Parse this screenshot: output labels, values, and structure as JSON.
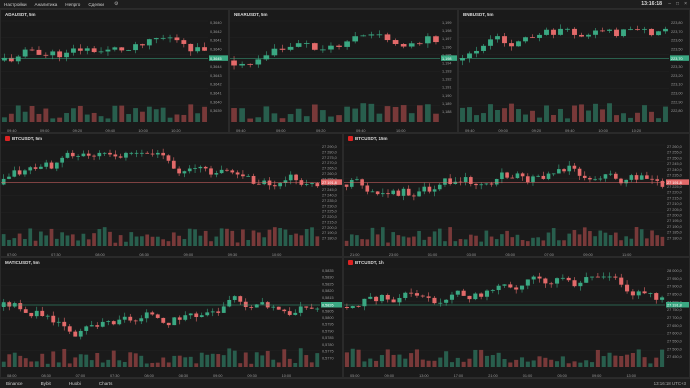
{
  "menu": {
    "items": [
      "Настройки",
      "Аналитика",
      "Непрго",
      "Сделки"
    ]
  },
  "clock": "13:16:18",
  "window_controls": [
    "–",
    "□",
    "×"
  ],
  "colors": {
    "bull": "#3aa882",
    "bear": "#e36a6a",
    "vol_bull": "#2c6b57",
    "vol_bear": "#8a4040",
    "hline_green": "#3aa882",
    "hline_red": "#e36a6a",
    "active_head": "#273b66"
  },
  "panels": [
    {
      "id": "ada",
      "title": "ADAUSDT, 5m",
      "badge": false,
      "active": false,
      "y_ticks": [
        "0,3640",
        "0,3642",
        "0,3641",
        "0,3640",
        "0,3645",
        "0,3644",
        "0,3643",
        "0,3642",
        "0,3641",
        "0,3640",
        "0,3639"
      ],
      "x_ticks": [
        "09:40",
        "09:00",
        "09:20",
        "09:40",
        "10:00",
        "10:20"
      ],
      "price_tag": "0,3645",
      "tag_color": "#3aa882"
    },
    {
      "id": "near",
      "title": "NEARUSDT, 5m",
      "badge": false,
      "active": false,
      "y_ticks": [
        "1,199",
        "1,198",
        "1,197",
        "1,196",
        "1,195",
        "1,194",
        "1,193",
        "1,192",
        "1,191",
        "1,190",
        "1,189",
        "1,188"
      ],
      "x_ticks": [
        "09:40",
        "09:00",
        "09:20",
        "09:40",
        "10:00"
      ],
      "price_tag": "1,198",
      "tag_color": "#3aa882"
    },
    {
      "id": "bnb",
      "title": "BNBUSDT, 5m",
      "badge": false,
      "active": false,
      "y_ticks": [
        "223,80",
        "223,70",
        "223,60",
        "223,50",
        "223,40",
        "223,30",
        "223,20",
        "223,10",
        "223,00",
        "222,90",
        "222,80"
      ],
      "x_ticks": [
        "09:40",
        "09:00",
        "09:20",
        "09:40",
        "10:00",
        "10:20"
      ],
      "price_tag": "223,70",
      "tag_color": "#3aa882"
    },
    {
      "id": "btc5",
      "title": "BTCUSDT, 5m",
      "badge": true,
      "active": false,
      "y_ticks": [
        "27 290,0",
        "27 280,0",
        "27 275,0",
        "27 270,0",
        "27 265,0",
        "27 260,0",
        "27 255,0",
        "27 250,0",
        "27 245,0",
        "27 240,0",
        "27 235,0",
        "27 230,0",
        "27 225,0",
        "27 220,0",
        "27 215,0",
        "27 200,0",
        "27 190,0",
        "27 180,0"
      ],
      "x_ticks": [
        "07:00",
        "07:30",
        "08:00",
        "08:30",
        "09:00",
        "09:30",
        "10:00"
      ],
      "price_tag": "27 191,8",
      "tag_color": "#e36a6a"
    },
    {
      "id": "btc15",
      "title": "BTCUSDT, 15m",
      "badge": true,
      "active": false,
      "y_ticks": [
        "27 260,0",
        "27 255,0",
        "27 250,0",
        "27 245,0",
        "27 240,0",
        "27 235,0",
        "27 230,0",
        "27 225,0",
        "27 220,0",
        "27 215,0",
        "27 210,0",
        "27 205,0",
        "27 200,0",
        "27 195,0",
        "27 190,0",
        "27 185,0",
        "27 180,0"
      ],
      "x_ticks": [
        "21:00",
        "23:00",
        "01:00",
        "03:00",
        "05:00",
        "07:00",
        "09:00",
        "11:00"
      ],
      "price_tag": "27 191,8",
      "tag_color": "#e36a6a"
    },
    {
      "id": "matic",
      "title": "MATICUSDT, 5m",
      "badge": false,
      "active": false,
      "y_ticks": [
        "0,5835",
        "0,5830",
        "0,5825",
        "0,5820",
        "0,5815",
        "0,5810",
        "0,5805",
        "0,5800",
        "0,5795",
        "0,5790",
        "0,5785",
        "0,5780",
        "0,5775",
        "0,5770"
      ],
      "x_ticks": [
        "08:00",
        "08:30",
        "07:00",
        "07:30",
        "08:00",
        "08:30",
        "09:00",
        "09:30",
        "10:00"
      ],
      "price_tag": "0,5826",
      "tag_color": "#3aa882"
    },
    {
      "id": "btc1h",
      "title": "BTCUSDT, 1h",
      "badge": true,
      "active": true,
      "y_ticks": [
        "28 000,0",
        "27 950,0",
        "27 900,0",
        "27 850,0",
        "27 800,0",
        "27 750,0",
        "27 700,0",
        "27 650,0",
        "27 600,0",
        "27 550,0",
        "27 500,0",
        "27 450,0"
      ],
      "x_ticks": [
        "05:00",
        "09:00",
        "13:00",
        "17:00",
        "21:00",
        "01:00",
        "05:00",
        "09:00",
        "13:00"
      ],
      "price_tag": "27 191,8",
      "tag_color": "#3aa882"
    }
  ],
  "bottom": {
    "items": [
      "Binance",
      "Bybit",
      "Huobi",
      "Charts"
    ],
    "right_text": "13:16:18 UTC+3"
  }
}
